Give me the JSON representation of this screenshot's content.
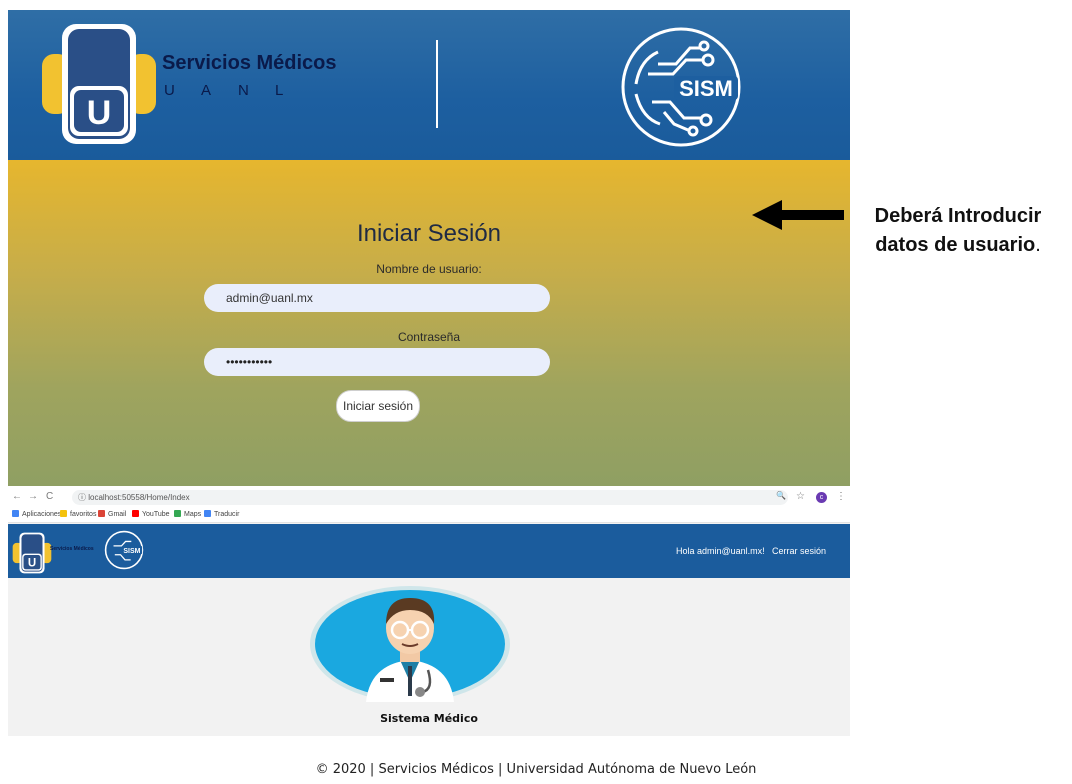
{
  "login": {
    "brand_title": "Servicios Médicos",
    "brand_letters": [
      "U",
      "A",
      "N",
      "L"
    ],
    "logo_letter": "U",
    "sism_text": "SISM",
    "title": "Iniciar Sesión",
    "username_label": "Nombre de usuario:",
    "username_value": "admin@uanl.mx",
    "password_label": "Contraseña",
    "password_value": "•••••••••••",
    "submit_label": "Iniciar sesión"
  },
  "annotation": {
    "line1": "Deberá Introducir",
    "line2": "datos de usuario",
    "punct": "."
  },
  "browser": {
    "back": "←",
    "forward": "→",
    "reload": "C",
    "info": "ⓘ",
    "url": "localhost:50558/Home/Index",
    "zoom": "🔍",
    "star": "☆",
    "menu": "⋮",
    "avatar_initial": "c",
    "bookmarks": [
      {
        "label": "Aplicaciones",
        "color": "#4285f4"
      },
      {
        "label": "favoritos",
        "color": "#f4c20d"
      },
      {
        "label": "Gmail",
        "color": "#db4437"
      },
      {
        "label": "YouTube",
        "color": "#ff0000"
      },
      {
        "label": "Maps",
        "color": "#34a853"
      },
      {
        "label": "Traducir",
        "color": "#4285f4"
      }
    ]
  },
  "app": {
    "mini_brand": "Servicios Médicos",
    "mini_letter": "U",
    "mini_sism": "SISM",
    "greeting": "Hola admin@uanl.mx!",
    "logout": "Cerrar sesión",
    "home_title": "Sistema Médico"
  },
  "footer": {
    "text": "© 2020 | Servicios Médicos | Universidad Autónoma de Nuevo León"
  },
  "colors": {
    "header_blue": "#1d5fa0",
    "gold": "#e6b62e",
    "logo_yellow": "#f2c230",
    "logo_navy": "#2a4f87"
  }
}
